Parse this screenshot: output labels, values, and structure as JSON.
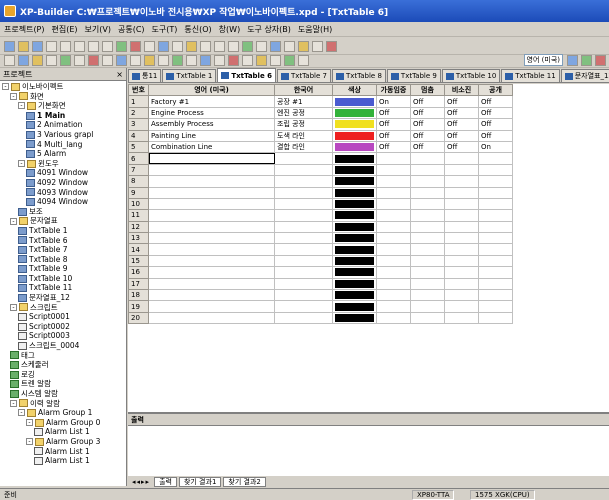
{
  "window": {
    "title": "XP-Builder C:₩프로젝트₩이노바 전시용₩XP 작업₩이노바이펙트.xpd - [TxtTable 6]"
  },
  "menu": [
    "프로젝트(P)",
    "편집(E)",
    "보기(V)",
    "공통(C)",
    "도구(T)",
    "통신(O)",
    "창(W)",
    "도구 상자(B)",
    "도움말(H)"
  ],
  "toolbar": {
    "lang_combo": "영어 (미국)"
  },
  "left_panel": {
    "title": "프로젝트",
    "close": "× ",
    "tree": [
      {
        "label": "이노바이펙트",
        "level": 0,
        "icon": "project",
        "tog": "-"
      },
      {
        "label": "화면",
        "level": 1,
        "icon": "folder",
        "tog": "-"
      },
      {
        "label": "기본화면",
        "level": 2,
        "icon": "folder",
        "tog": "-"
      },
      {
        "label": "1 Main",
        "level": 3,
        "icon": "screen",
        "bold": true
      },
      {
        "label": "2 Animation",
        "level": 3,
        "icon": "screen"
      },
      {
        "label": "3 Various grapl",
        "level": 3,
        "icon": "screen"
      },
      {
        "label": "4 Multi_lang",
        "level": 3,
        "icon": "screen"
      },
      {
        "label": "5 Alarm",
        "level": 3,
        "icon": "screen"
      },
      {
        "label": "윈도우",
        "level": 2,
        "icon": "folder",
        "tog": "-"
      },
      {
        "label": "4091 Window",
        "level": 3,
        "icon": "screen"
      },
      {
        "label": "4092 Window",
        "level": 3,
        "icon": "screen"
      },
      {
        "label": "4093 Window",
        "level": 3,
        "icon": "screen"
      },
      {
        "label": "4094 Window",
        "level": 3,
        "icon": "screen"
      },
      {
        "label": "보조",
        "level": 2,
        "icon": "screen"
      },
      {
        "label": "문자열표",
        "level": 1,
        "icon": "folder",
        "tog": "-"
      },
      {
        "label": "TxtTable 1",
        "level": 2,
        "icon": "txt"
      },
      {
        "label": "TxtTable 6",
        "level": 2,
        "icon": "txt"
      },
      {
        "label": "TxtTable 7",
        "level": 2,
        "icon": "txt"
      },
      {
        "label": "TxtTable 8",
        "level": 2,
        "icon": "txt"
      },
      {
        "label": "TxtTable 9",
        "level": 2,
        "icon": "txt"
      },
      {
        "label": "TxtTable 10",
        "level": 2,
        "icon": "txt"
      },
      {
        "label": "TxtTable 11",
        "level": 2,
        "icon": "txt"
      },
      {
        "label": "문자열표_12",
        "level": 2,
        "icon": "txt"
      },
      {
        "label": "스크립트",
        "level": 1,
        "icon": "folder",
        "tog": "-"
      },
      {
        "label": "Script0001",
        "level": 2,
        "icon": "doc"
      },
      {
        "label": "Script0002",
        "level": 2,
        "icon": "doc"
      },
      {
        "label": "Script0003",
        "level": 2,
        "icon": "doc"
      },
      {
        "label": "스크립트_0004",
        "level": 2,
        "icon": "doc"
      },
      {
        "label": "태그",
        "level": 1,
        "icon": "green"
      },
      {
        "label": "스케줄러",
        "level": 1,
        "icon": "green"
      },
      {
        "label": "로깅",
        "level": 1,
        "icon": "green"
      },
      {
        "label": "트렌 알람",
        "level": 1,
        "icon": "green"
      },
      {
        "label": "시스템 알람",
        "level": 1,
        "icon": "green"
      },
      {
        "label": "이력 알람",
        "level": 1,
        "icon": "folder",
        "tog": "-"
      },
      {
        "label": "Alarm Group 1",
        "level": 2,
        "icon": "folder",
        "tog": "-"
      },
      {
        "label": "Alarm Group 0",
        "level": 3,
        "icon": "folder",
        "tog": "-"
      },
      {
        "label": "Alarm List 1",
        "level": 4,
        "icon": "doc"
      },
      {
        "label": "Alarm Group 3",
        "level": 3,
        "icon": "folder",
        "tog": "-"
      },
      {
        "label": "Alarm List 1",
        "level": 4,
        "icon": "doc"
      },
      {
        "label": "Alarm List 1",
        "level": 4,
        "icon": "doc"
      }
    ]
  },
  "tabs": [
    {
      "label": "통11",
      "active": false
    },
    {
      "label": "TxtTable 1",
      "active": false
    },
    {
      "label": "TxtTable 6",
      "active": true
    },
    {
      "label": "TxtTable 7",
      "active": false
    },
    {
      "label": "TxtTable 8",
      "active": false
    },
    {
      "label": "TxtTable 9",
      "active": false
    },
    {
      "label": "TxtTable 10",
      "active": false
    },
    {
      "label": "TxtTable 11",
      "active": false
    },
    {
      "label": "문자열표_12",
      "active": false
    }
  ],
  "table": {
    "headers": [
      "번호",
      "영어 (미국)",
      "한국어",
      "색상",
      "가동임중",
      "멈춤",
      "비소진",
      "공개"
    ],
    "rows": [
      {
        "n": "1",
        "en": "Factory #1",
        "ko": "공장 #1",
        "color": "#4a5bd0",
        "c4": "On",
        "c5": "Off",
        "c6": "Off",
        "c7": "Off"
      },
      {
        "n": "2",
        "en": "Engine Process",
        "ko": "엔진 공정",
        "color": "#33b23a",
        "c4": "Off",
        "c5": "Off",
        "c6": "Off",
        "c7": "Off"
      },
      {
        "n": "3",
        "en": "Assembly Process",
        "ko": "조립 공정",
        "color": "#f0e020",
        "c4": "Off",
        "c5": "Off",
        "c6": "Off",
        "c7": "Off"
      },
      {
        "n": "4",
        "en": "Painting Line",
        "ko": "도색 라인",
        "color": "#ee2020",
        "c4": "Off",
        "c5": "Off",
        "c6": "Off",
        "c7": "Off"
      },
      {
        "n": "5",
        "en": "Combination Line",
        "ko": "결합 라인",
        "color": "#b848c0",
        "c4": "Off",
        "c5": "Off",
        "c6": "Off",
        "c7": "On"
      },
      {
        "n": "6",
        "en": "",
        "ko": "",
        "color": "#000000",
        "c4": "",
        "c5": "",
        "c6": "",
        "c7": ""
      },
      {
        "n": "7",
        "en": "",
        "ko": "",
        "color": "#000000",
        "c4": "",
        "c5": "",
        "c6": "",
        "c7": ""
      },
      {
        "n": "8",
        "en": "",
        "ko": "",
        "color": "#000000",
        "c4": "",
        "c5": "",
        "c6": "",
        "c7": ""
      },
      {
        "n": "9",
        "en": "",
        "ko": "",
        "color": "#000000",
        "c4": "",
        "c5": "",
        "c6": "",
        "c7": ""
      },
      {
        "n": "10",
        "en": "",
        "ko": "",
        "color": "#000000",
        "c4": "",
        "c5": "",
        "c6": "",
        "c7": ""
      },
      {
        "n": "11",
        "en": "",
        "ko": "",
        "color": "#000000",
        "c4": "",
        "c5": "",
        "c6": "",
        "c7": ""
      },
      {
        "n": "12",
        "en": "",
        "ko": "",
        "color": "#000000",
        "c4": "",
        "c5": "",
        "c6": "",
        "c7": ""
      },
      {
        "n": "13",
        "en": "",
        "ko": "",
        "color": "#000000",
        "c4": "",
        "c5": "",
        "c6": "",
        "c7": ""
      },
      {
        "n": "14",
        "en": "",
        "ko": "",
        "color": "#000000",
        "c4": "",
        "c5": "",
        "c6": "",
        "c7": ""
      },
      {
        "n": "15",
        "en": "",
        "ko": "",
        "color": "#000000",
        "c4": "",
        "c5": "",
        "c6": "",
        "c7": ""
      },
      {
        "n": "16",
        "en": "",
        "ko": "",
        "color": "#000000",
        "c4": "",
        "c5": "",
        "c6": "",
        "c7": ""
      },
      {
        "n": "17",
        "en": "",
        "ko": "",
        "color": "#000000",
        "c4": "",
        "c5": "",
        "c6": "",
        "c7": ""
      },
      {
        "n": "18",
        "en": "",
        "ko": "",
        "color": "#000000",
        "c4": "",
        "c5": "",
        "c6": "",
        "c7": ""
      },
      {
        "n": "19",
        "en": "",
        "ko": "",
        "color": "#000000",
        "c4": "",
        "c5": "",
        "c6": "",
        "c7": ""
      },
      {
        "n": "20",
        "en": "",
        "ko": "",
        "color": "#000000",
        "c4": "",
        "c5": "",
        "c6": "",
        "c7": ""
      }
    ]
  },
  "output": {
    "title": "출력"
  },
  "bottom_tabs": {
    "nav": "◂◂▸▸",
    "items": [
      "출력",
      "찾기 결과1",
      "찾기 결과2"
    ]
  },
  "status": {
    "left": "준비",
    "mid": "XP80-TTA",
    "right": "1575 XGK(CPU)"
  }
}
